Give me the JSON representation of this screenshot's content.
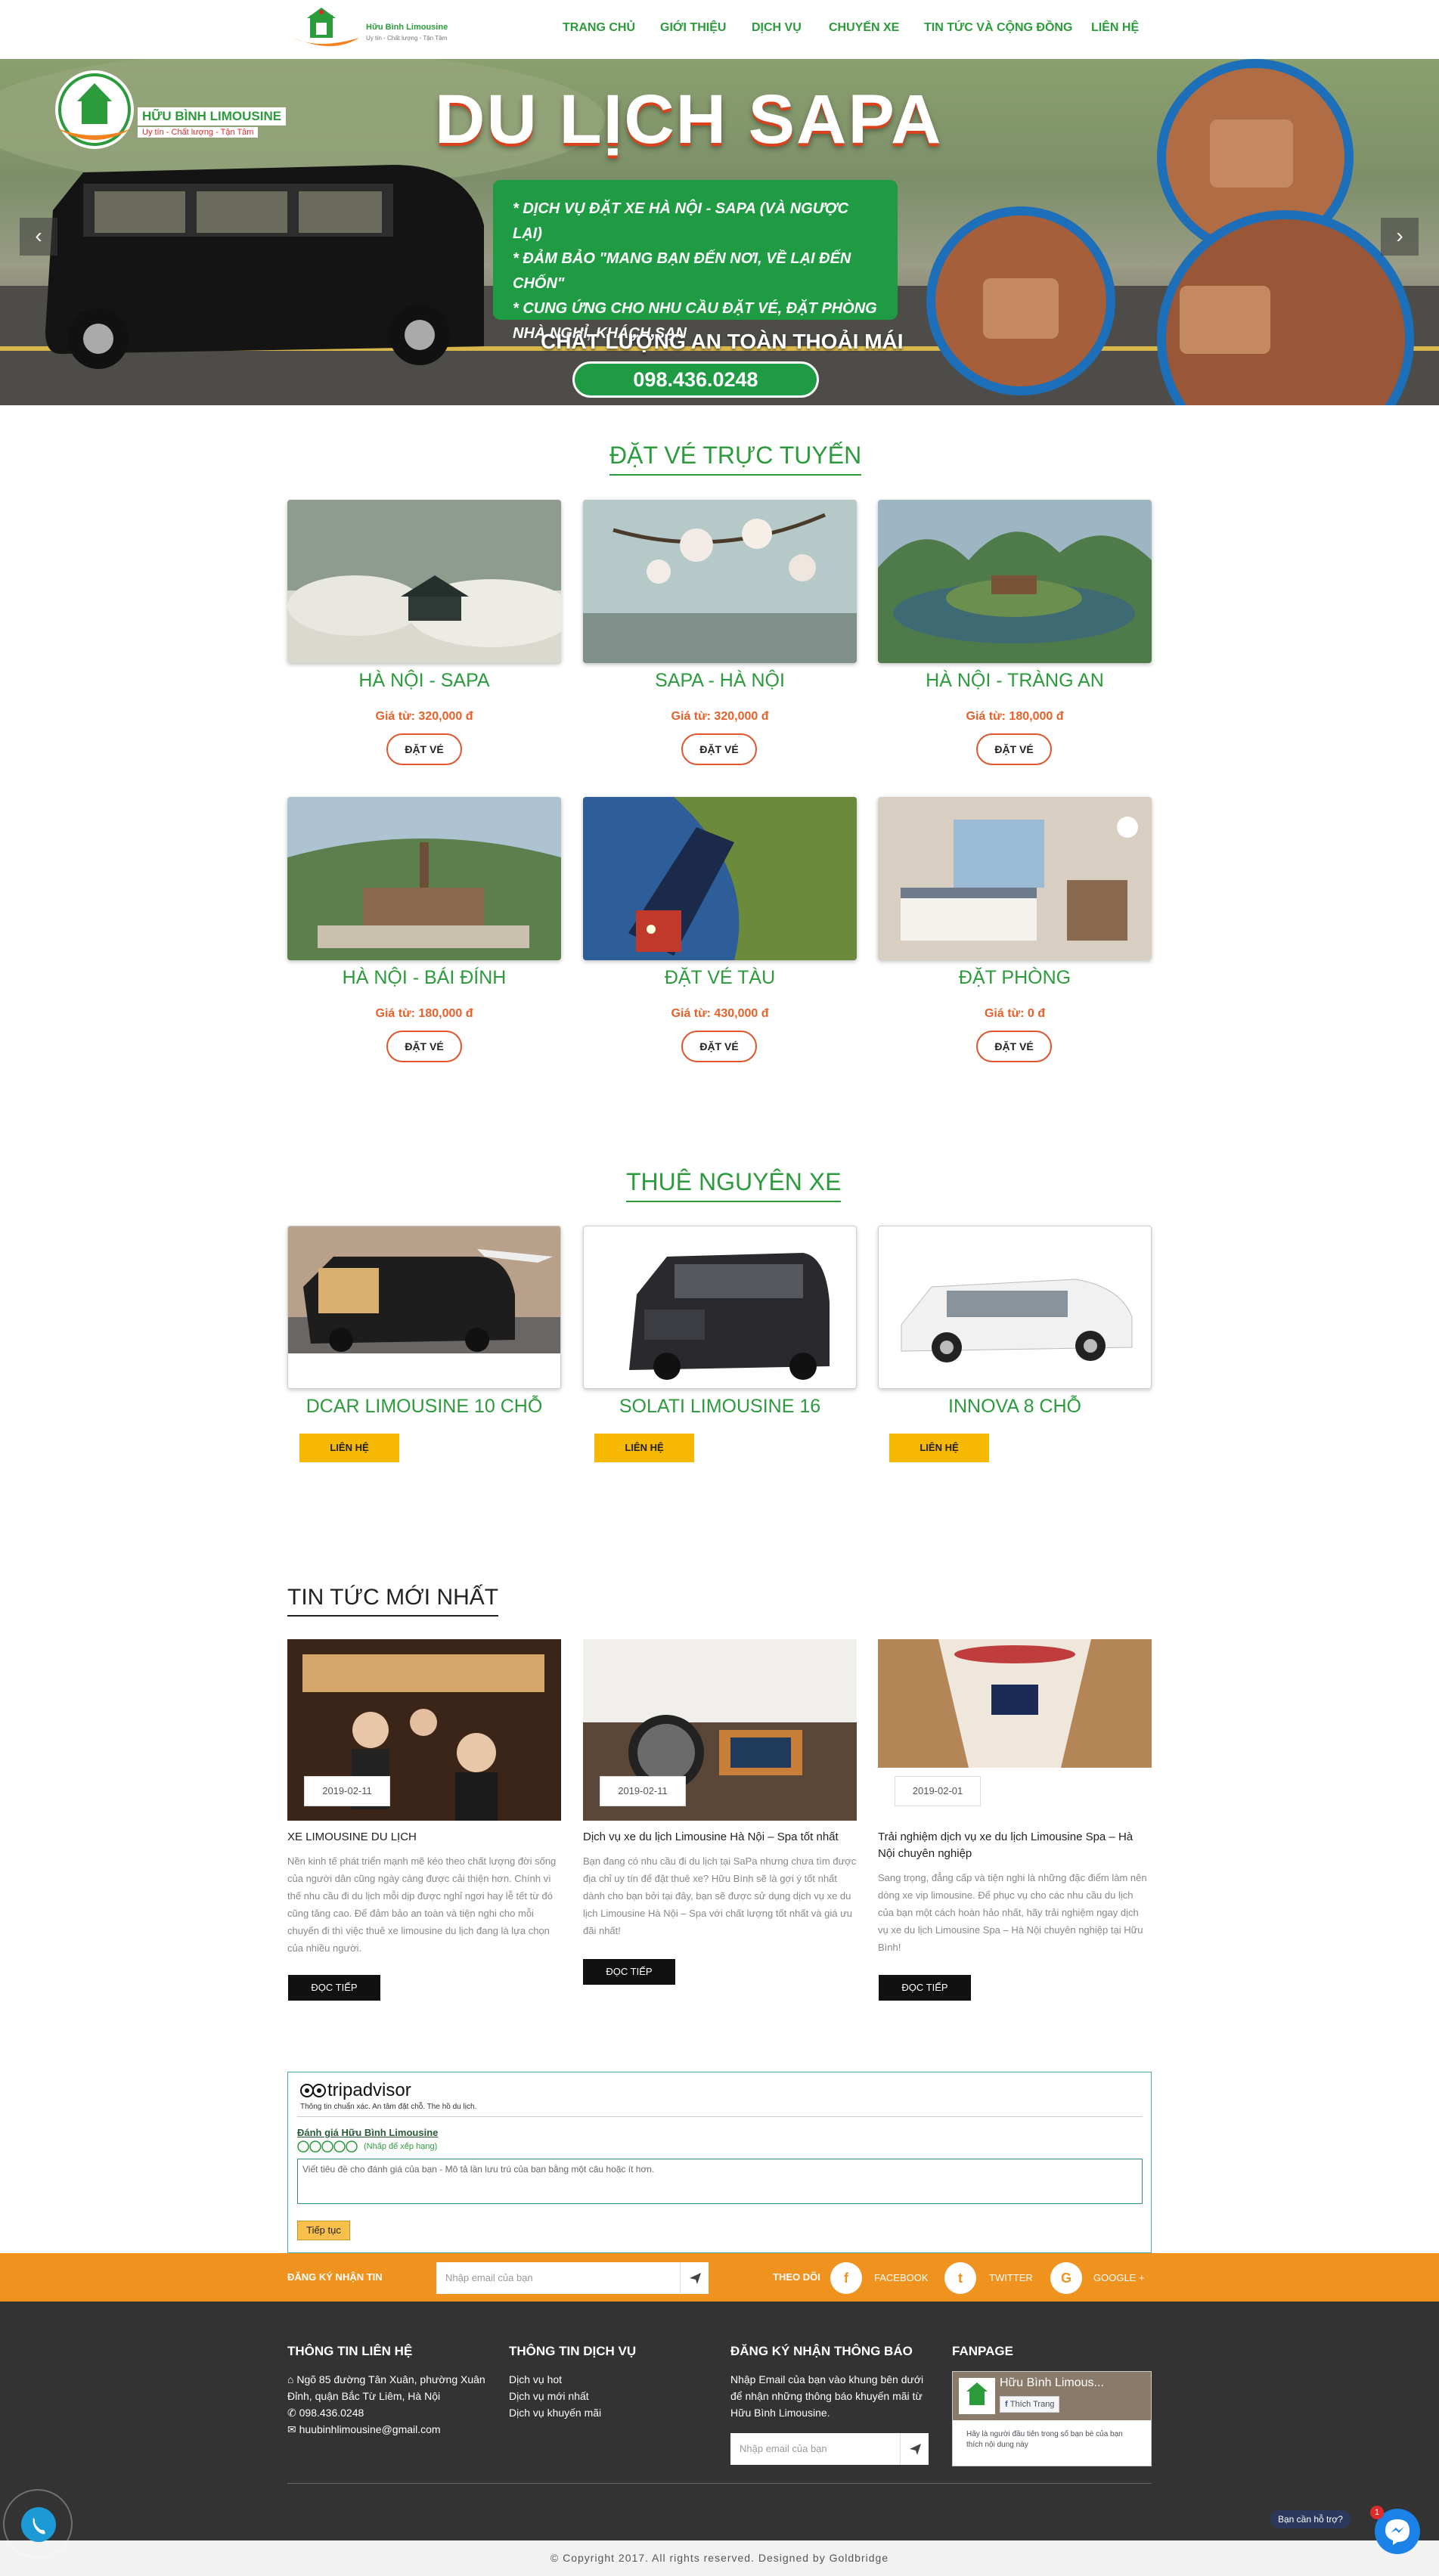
{
  "header": {
    "logo_text": "Hữu Bình Limousine",
    "logo_sub": "Uy tín - Chất lượng - Tận Tâm",
    "nav": [
      "TRANG CHỦ",
      "GIỚI THIỆU",
      "DỊCH VỤ",
      "CHUYẾN XE",
      "TIN TỨC VÀ CỘNG ĐỒNG",
      "LIÊN HỆ"
    ]
  },
  "banner": {
    "brand": "HỮU BÌNH LIMOUSINE",
    "brand_sub": "Uy tín - Chất lượng - Tận Tâm",
    "title": "DU LỊCH SAPA",
    "bullets": [
      "* DỊCH VỤ ĐẶT XE HÀ NỘI - SAPA (VÀ NGƯỢC LẠI)",
      "* ĐẢM BẢO \"MANG BẠN ĐẾN NƠI, VỀ LẠI ĐẾN CHỐN\"",
      "* CUNG ỨNG CHO NHU CẦU ĐẶT VÉ, ĐẶT PHÒNG",
      "NHÀ NGHỈ, KHÁCH SẠN"
    ],
    "slogan": "CHẤT LƯỢNG AN TOÀN THOẢI MÁI",
    "phone": "098.436.0248",
    "prev": "‹",
    "next": "›"
  },
  "tickets": {
    "title": "ĐẶT VÉ TRỰC TUYẾN",
    "button": "ĐẶT VÉ",
    "items": [
      {
        "name": "HÀ NỘI - SAPA",
        "price": "Giá từ: 320,000 đ"
      },
      {
        "name": "SAPA - HÀ NỘI",
        "price": "Giá từ: 320,000 đ"
      },
      {
        "name": "HÀ NỘI - TRÀNG AN",
        "price": "Giá từ: 180,000 đ"
      },
      {
        "name": "HÀ NỘI - BÁI ĐÍNH",
        "price": "Giá từ: 180,000 đ"
      },
      {
        "name": "ĐẶT VÉ TÀU",
        "price": "Giá từ: 430,000 đ"
      },
      {
        "name": "ĐẶT PHÒNG",
        "price": "Giá từ: 0 đ"
      }
    ]
  },
  "cars": {
    "title": "THUÊ NGUYÊN XE",
    "button": "LIÊN HỆ",
    "items": [
      {
        "name": "DCAR LIMOUSINE 10 CHỖ"
      },
      {
        "name": "SOLATI LIMOUSINE 16"
      },
      {
        "name": "INNOVA 8 CHỖ"
      }
    ]
  },
  "news": {
    "title": "TIN TỨC MỚI NHẤT",
    "button": "ĐỌC TIẾP",
    "items": [
      {
        "date": "2019-02-11",
        "title": "XE LIMOUSINE DU LỊCH",
        "desc": "Nền kinh tế phát triển mạnh mẽ kéo theo chất lượng đời sống của người dân cũng ngày càng được cải thiện hơn. Chính vì thế nhu cầu đi du lịch mỗi dịp được nghỉ ngơi hay lễ tết từ đó cũng tăng cao. Để đảm bảo an toàn và tiện nghi cho mỗi chuyến đi thì việc thuê xe limousine du lịch đang là lựa chọn của nhiều người."
      },
      {
        "date": "2019-02-11",
        "title": "Dịch vụ xe du lịch Limousine Hà Nội – Spa tốt nhất",
        "desc": "Bạn đang có nhu cầu đi du lịch tại SaPa nhưng chưa tìm được địa chỉ uy tín để đặt thuê xe? Hữu Bình sẽ là gợi ý tốt nhất dành cho bạn bởi tại đây, bạn sẽ được sử dụng dịch vụ xe du lịch Limousine Hà Nội – Spa với chất lượng tốt nhất và giá ưu đãi nhất!"
      },
      {
        "date": "2019-02-01",
        "title": "Trải nghiệm dịch vụ xe du lịch Limousine Spa – Hà Nội chuyên nghiệp",
        "desc": "Sang trọng, đẳng cấp và tiện nghi là những đặc điểm làm nên dòng xe vip limousine. Để phục vụ cho các nhu cầu du lịch của bạn một cách hoàn hảo nhất, hãy trải nghiệm ngay dịch vụ xe du lịch Limousine Spa – Hà Nội chuyên nghiệp tại Hữu Bình!"
      }
    ]
  },
  "tripadvisor": {
    "logo": "tripadvisor",
    "tagline": "Thông tin chuẩn xác. An tâm đặt chỗ. The hồ du lịch.",
    "review_link": "Đánh giá Hữu Bình Limousine",
    "rating_hint": "(Nhấp để xếp hạng)",
    "placeholder": "Viết tiêu đề cho đánh giá của bạn - Mô tả lần lưu trú của bạn bằng một câu hoặc ít hơn.",
    "continue": "Tiếp tục"
  },
  "subscribe_bar": {
    "label": "ĐĂNG KÝ NHẬN TIN",
    "placeholder": "Nhập email của bạn",
    "follow": "THEO DÕI",
    "facebook": "FACEBOOK",
    "twitter": "TWITTER",
    "google": "GOOGLE +"
  },
  "footer": {
    "contact_title": "THÔNG TIN LIÊN HỆ",
    "address": "Ngõ 85 đường Tân Xuân, phường Xuân Đỉnh, quận Bắc Từ Liêm, Hà Nội",
    "phone": "098.436.0248",
    "email": "huubinhlimousine@gmail.com",
    "service_title": "THÔNG TIN DỊCH VỤ",
    "services": [
      "Dịch vụ hot",
      "Dịch vụ mới nhất",
      "Dịch vụ khuyến mãi"
    ],
    "newsletter_title": "ĐĂNG KÝ NHẬN THÔNG BÁO",
    "newsletter_text": "Nhập Email của bạn vào khung bên dưới để nhận những thông báo khuyến mãi từ Hữu Bình Limousine.",
    "newsletter_placeholder": "Nhập email của bạn",
    "fanpage_title": "FANPAGE",
    "fanpage_name": "Hữu Bình Limous...",
    "fanpage_like": "Thích Trang",
    "fanpage_note": "Hãy là người đầu tiên trong số bạn bè của bạn thích nội dung này",
    "copyright": "© Copyright 2017. All rights reserved. Designed by Goldbridge"
  },
  "widgets": {
    "chat_label": "Bạn cần hỗ trợ?",
    "chat_badge": "1"
  }
}
